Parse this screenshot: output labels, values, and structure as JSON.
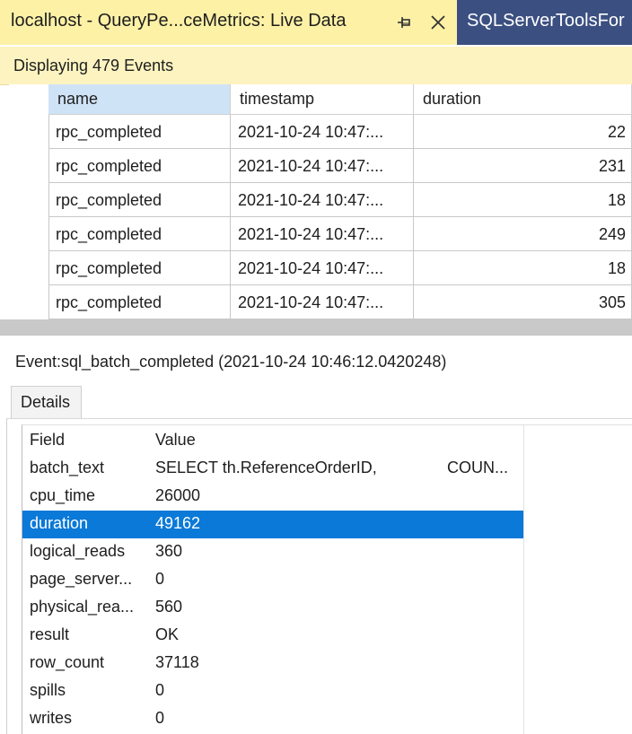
{
  "tabs": {
    "active_label": "localhost - QueryPe...ceMetrics: Live Data",
    "inactive_label": "SQLServerToolsFor"
  },
  "status": {
    "text": "Displaying 479 Events"
  },
  "grid": {
    "columns": [
      "name",
      "timestamp",
      "duration"
    ],
    "rows": [
      [
        "rpc_completed",
        "2021-10-24 10:47:...",
        "22"
      ],
      [
        "rpc_completed",
        "2021-10-24 10:47:...",
        "231"
      ],
      [
        "rpc_completed",
        "2021-10-24 10:47:...",
        "18"
      ],
      [
        "rpc_completed",
        "2021-10-24 10:47:...",
        "249"
      ],
      [
        "rpc_completed",
        "2021-10-24 10:47:...",
        "18"
      ],
      [
        "rpc_completed",
        "2021-10-24 10:47:...",
        "305"
      ]
    ]
  },
  "details": {
    "event_title": "Event:sql_batch_completed (2021-10-24 10:46:12.0420248)",
    "tab_label": "Details",
    "header": {
      "field": "Field",
      "value": "Value"
    },
    "rows": [
      {
        "field": "batch_text",
        "value": "SELECT th.ReferenceOrderID,",
        "value_extra": "COUN..."
      },
      {
        "field": "cpu_time",
        "value": "26000"
      },
      {
        "field": "duration",
        "value": "49162",
        "selected": true
      },
      {
        "field": "logical_reads",
        "value": "360"
      },
      {
        "field": "page_server...",
        "value": "0"
      },
      {
        "field": "physical_rea...",
        "value": "560"
      },
      {
        "field": "result",
        "value": "OK"
      },
      {
        "field": "row_count",
        "value": "37118"
      },
      {
        "field": "spills",
        "value": "0"
      },
      {
        "field": "writes",
        "value": "0"
      }
    ]
  },
  "colors": {
    "selection": "#0a79d7",
    "active_tab": "#fdf1a6",
    "inactive_tab": "#3b4f81"
  }
}
